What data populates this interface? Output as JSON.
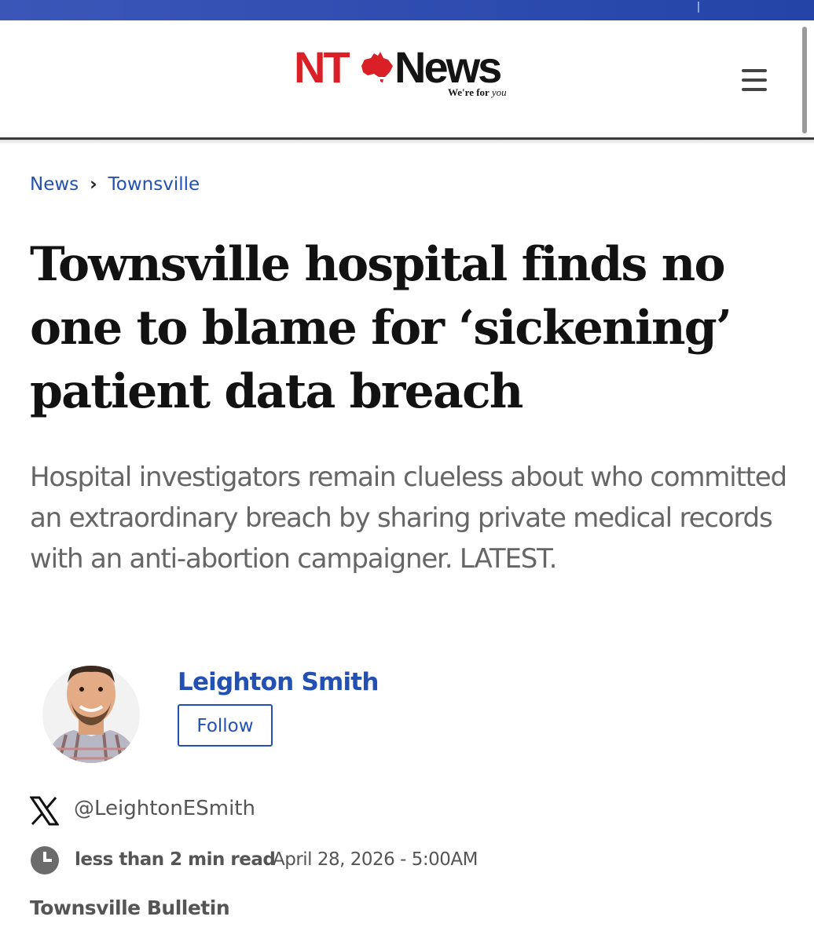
{
  "brand": {
    "name_nt": "NT",
    "name_news": "News",
    "tagline_main": "We're for",
    "tagline_script": "you",
    "red": "#d92027"
  },
  "header": {
    "menu_icon": "hamburger-menu-icon"
  },
  "breadcrumb": {
    "items": [
      "News",
      "Townsville"
    ]
  },
  "article": {
    "headline": "Townsville hospital finds no one to blame for ‘sickening’ patient data breach",
    "standfirst": "Hospital investigators remain clueless about who committed an extraordinary breach by sharing private medical records with an anti-abortion campaigner. LATEST."
  },
  "author": {
    "name": "Leighton Smith",
    "follow_label": "Follow",
    "x_handle": "@LeightonESmith"
  },
  "meta": {
    "read_time": "less than 2 min read",
    "published": "April 28, 2026 - 5:00AM",
    "source": "Townsville Bulletin"
  },
  "colors": {
    "link": "#2251b3",
    "text": "#121212",
    "muted": "#666666",
    "topbar": "#2444a8"
  }
}
